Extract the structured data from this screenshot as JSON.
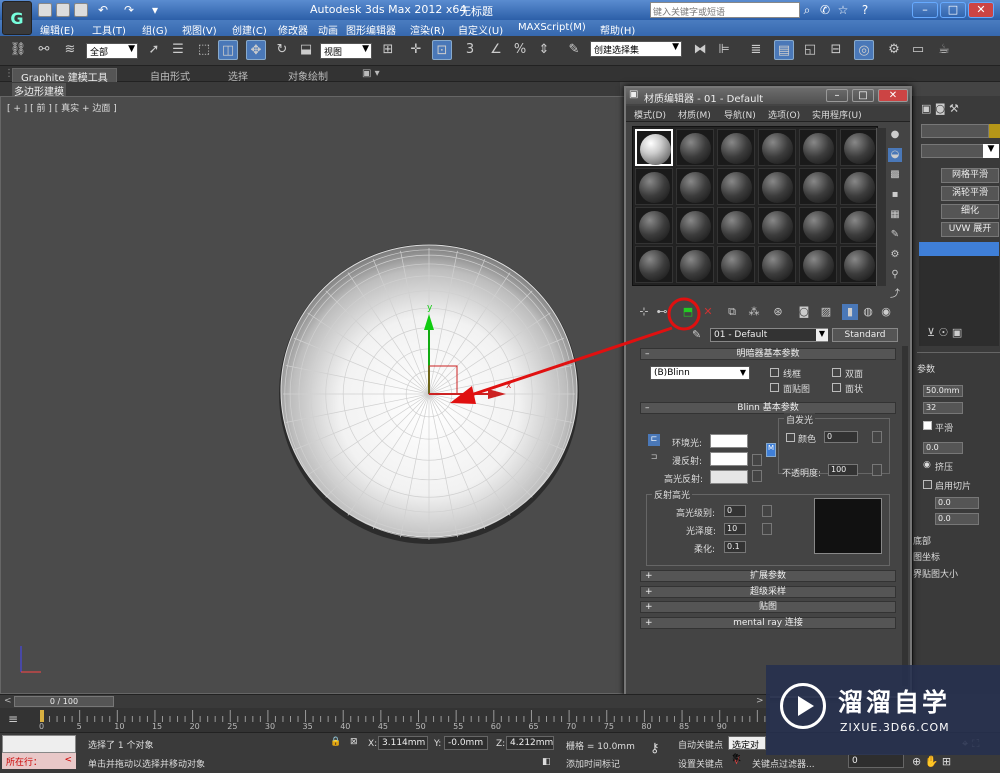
{
  "titlebar": {
    "app_title": "Autodesk 3ds Max  2012 x64",
    "file_name": "无标题",
    "search_placeholder": "键入关键字或短语",
    "window_controls": [
      "–",
      "□",
      "✕"
    ]
  },
  "menu": [
    "编辑(E)",
    "工具(T)",
    "组(G)",
    "视图(V)",
    "创建(C)",
    "修改器",
    "动画",
    "图形编辑器",
    "渲染(R)",
    "自定义(U)",
    "MAXScript(M)",
    "帮助(H)"
  ],
  "toolbar": {
    "selection_filter": "全部",
    "reference_coord": "视图",
    "named_selection": "创建选择集"
  },
  "ribbon": {
    "tabs": [
      "Graphite 建模工具",
      "自由形式",
      "选择",
      "对象绘制"
    ],
    "sub_label": "多边形建模"
  },
  "viewport": {
    "label": "[ + ] [ 前 ] [ 真实 + 边面 ]",
    "gizmo_y": "y",
    "gizmo_x": "x"
  },
  "material_editor": {
    "title": "材质编辑器 - 01 - Default",
    "menu": [
      "模式(D)",
      "材质(M)",
      "导航(N)",
      "选项(O)",
      "实用程序(U)"
    ],
    "material_name": "01 - Default",
    "material_type": "Standard",
    "shader_rollout": {
      "title": "明暗器基本参数",
      "shader": "(B)Blinn",
      "options": [
        "线框",
        "双面",
        "面贴图",
        "面状"
      ]
    },
    "blinn_rollout": {
      "title": "Blinn 基本参数",
      "self_illum_label": "自发光",
      "color_label": "颜色",
      "color_value": "0",
      "ambient": "环境光:",
      "diffuse": "漫反射:",
      "specular": "高光反射:",
      "opacity_label": "不透明度:",
      "opacity_value": "100",
      "specular_highlights": "反射高光",
      "spec_level_label": "高光级别:",
      "spec_level": "0",
      "glossiness_label": "光泽度:",
      "glossiness": "10",
      "soften_label": "柔化:",
      "soften": "0.1"
    },
    "collapsed_rollouts": [
      "扩展参数",
      "超级采样",
      "贴图",
      "mental ray 连接"
    ]
  },
  "command_panel": {
    "buttons": [
      "网格平滑",
      "涡轮平滑",
      "细化",
      "UVW 展开"
    ],
    "params_title": "参数",
    "radius": "50.0mm",
    "segments": "32",
    "smooth_label": "平滑",
    "hemisphere": "0.0",
    "squash_label": "挤压",
    "slice_label": "启用切片",
    "slice_from": "0.0",
    "slice_to": "0.0",
    "base_pivot_label": "底部",
    "gen_map_label": "图坐标",
    "real_world_label": "界贴图大小"
  },
  "timeline": {
    "frame": "0 / 100",
    "ticks": [
      "0",
      "5",
      "10",
      "15",
      "20",
      "25",
      "30",
      "35",
      "40",
      "45",
      "50",
      "55",
      "60",
      "65",
      "70",
      "75",
      "80",
      "85",
      "90"
    ]
  },
  "status": {
    "maxscript_label": "所在行：",
    "selection": "选择了 1 个对象",
    "prompt": "单击并拖动以选择并移动对象",
    "x_label": "X:",
    "x": "3.114mm",
    "y_label": "Y:",
    "y": "-0.0mm",
    "z_label": "Z:",
    "z": "4.212mm",
    "grid": "栅格 = 10.0mm",
    "add_time_tag": "添加时间标记",
    "auto_key": "自动关键点",
    "set_key": "设置关键点",
    "selected": "选定对象",
    "key_filters": "关键点过滤器...",
    "frame_value": "0"
  },
  "watermark": {
    "brand": "溜溜自学",
    "url": "ZIXUE.3D66.COM"
  },
  "colors": {
    "annotation_red": "#e01010",
    "highlight_blue": "#3f7fd8"
  }
}
